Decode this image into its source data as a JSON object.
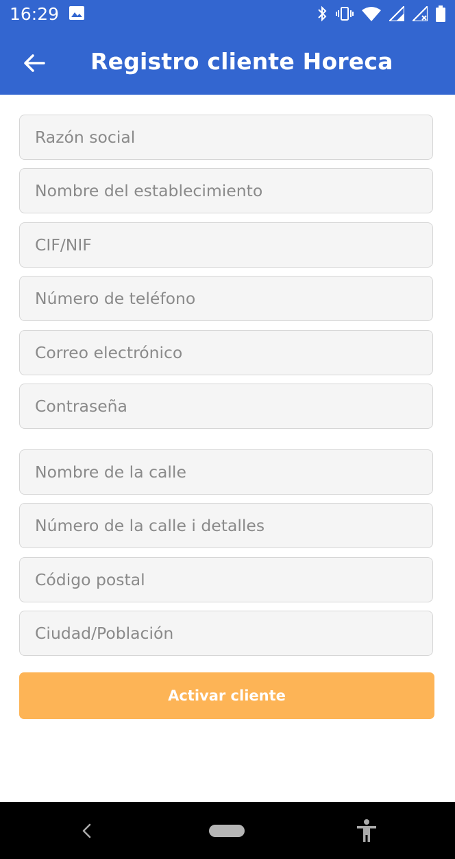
{
  "status_bar": {
    "time": "16:29",
    "icons": [
      "image-icon",
      "bluetooth-icon",
      "vibrate-icon",
      "wifi-icon",
      "signal-icon",
      "signal-x-icon",
      "battery-icon"
    ]
  },
  "appbar": {
    "title": "Registro cliente Horeca",
    "back_icon": "arrow-left-icon",
    "color": "#3366d0"
  },
  "form": {
    "fields": [
      {
        "placeholder": "Razón social",
        "value": ""
      },
      {
        "placeholder": "Nombre del establecimiento",
        "value": ""
      },
      {
        "placeholder": "CIF/NIF",
        "value": ""
      },
      {
        "placeholder": "Número de teléfono",
        "value": ""
      },
      {
        "placeholder": "Correo electrónico",
        "value": ""
      },
      {
        "placeholder": "Contraseña",
        "value": ""
      },
      {
        "placeholder": "Nombre de la calle",
        "value": ""
      },
      {
        "placeholder": "Número de la calle i detalles",
        "value": ""
      },
      {
        "placeholder": "Código postal",
        "value": ""
      },
      {
        "placeholder": "Ciudad/Población",
        "value": ""
      }
    ],
    "submit_label": "Activar cliente",
    "submit_color": "#fdb456"
  },
  "nav_bar": {
    "icons": [
      "nav-back-icon",
      "nav-home-pill",
      "accessibility-icon"
    ]
  }
}
